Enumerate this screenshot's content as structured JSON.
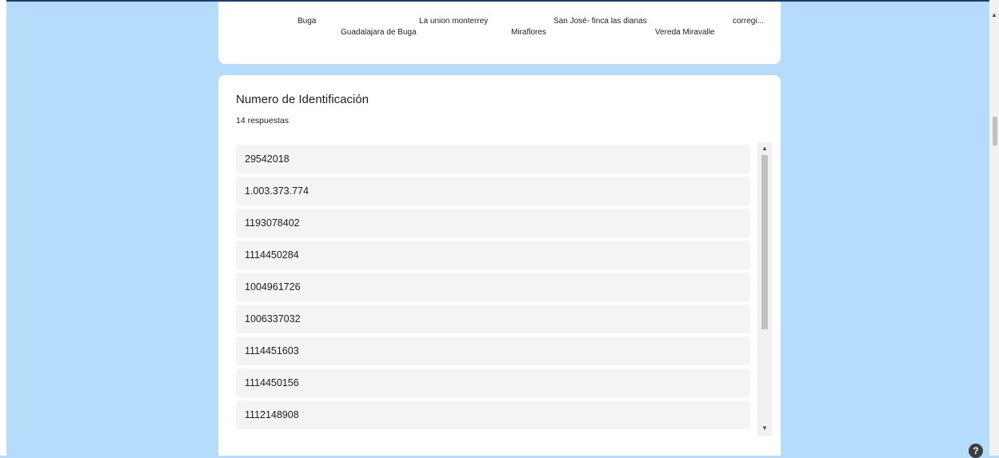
{
  "chart_labels": {
    "row1": [
      "Buga",
      "La union monterrey",
      "San José- finca las dianas",
      "corregi..."
    ],
    "row2": [
      "Guadalajara de Buga",
      "Miraflores",
      "Vereda Miravalle"
    ]
  },
  "question": {
    "title": "Numero de Identificación",
    "count": "14 respuestas",
    "responses": [
      "29542018",
      "1.003.373.774",
      "1193078402",
      "1114450284",
      "1004961726",
      "1006337032",
      "1114451603",
      "1114450156",
      "1112148908"
    ]
  },
  "icons": {
    "scroll_up": "scroll-up-arrow-icon",
    "scroll_down": "scroll-down-arrow-icon",
    "help": "help-icon"
  },
  "colors": {
    "page_background": "#b6dcfb",
    "card": "#ffffff",
    "response_row": "#f3f4f5"
  }
}
